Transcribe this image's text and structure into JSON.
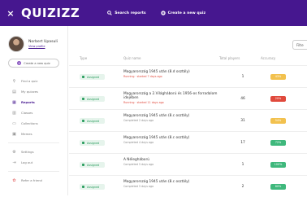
{
  "header": {
    "close": "×",
    "logo": "QUIZIZZ",
    "search_reports": "Search reports",
    "create_quiz": "Create a new quiz"
  },
  "sidebar": {
    "user_name": "Norbert Upasuli",
    "view_profile": "View profile",
    "create_button": "Create a new quiz",
    "items": [
      {
        "label": "Find a quiz",
        "icon": "search-icon"
      },
      {
        "label": "My quizzes",
        "icon": "quizzes-icon"
      },
      {
        "label": "Reports",
        "icon": "reports-icon",
        "active": true
      },
      {
        "label": "Classes",
        "icon": "classes-icon"
      },
      {
        "label": "Collections",
        "icon": "collections-icon"
      },
      {
        "label": "Memes",
        "icon": "memes-icon"
      }
    ],
    "bottom_items": [
      {
        "label": "Settings",
        "icon": "gear-icon"
      },
      {
        "label": "Log out",
        "icon": "logout-icon"
      }
    ],
    "refer": {
      "label": "Refer a friend",
      "icon": "gift-icon"
    }
  },
  "main": {
    "filter_label": "Filte",
    "columns": {
      "type": "Type",
      "quiz_name": "Quiz name",
      "total_players": "Total players",
      "accuracy": "Accuracy"
    },
    "rows": [
      {
        "type": "Assigned",
        "name": "Magyarország 1945 után (8.d osztály)",
        "status": "Running · started 7 days ago",
        "running": true,
        "players": "1",
        "accuracy": "43%",
        "acc_color": "#f2c14e"
      },
      {
        "type": "Assigned",
        "name": "Magyarország a 2.Világháború és 1956-os forradalom idejében",
        "status": "Running · started 11 days ago",
        "running": true,
        "players": "46",
        "accuracy": "20%",
        "acc_color": "#e0493c"
      },
      {
        "type": "Assigned",
        "name": "Magyarország 1945 után (8.c osztály)",
        "status": "Completed 2 days ago",
        "running": false,
        "players": "31",
        "accuracy": "54%",
        "acc_color": "#f2c14e"
      },
      {
        "type": "Assigned",
        "name": "Magyarország 1945 után (8.c osztály)",
        "status": "Completed 4 days ago",
        "running": false,
        "players": "17",
        "accuracy": "72%",
        "acc_color": "#3fb87c"
      },
      {
        "type": "Assigned",
        "name": "A Nélegháború",
        "status": "Completed 5 days ago",
        "running": false,
        "players": "1",
        "accuracy": "100%",
        "acc_color": "#3fb87c"
      },
      {
        "type": "Assigned",
        "name": "Magyarország 1945 után (8.c osztály)",
        "status": "Completed 5 days ago",
        "running": false,
        "players": "2",
        "accuracy": "80%",
        "acc_color": "#3fb87c"
      }
    ]
  }
}
